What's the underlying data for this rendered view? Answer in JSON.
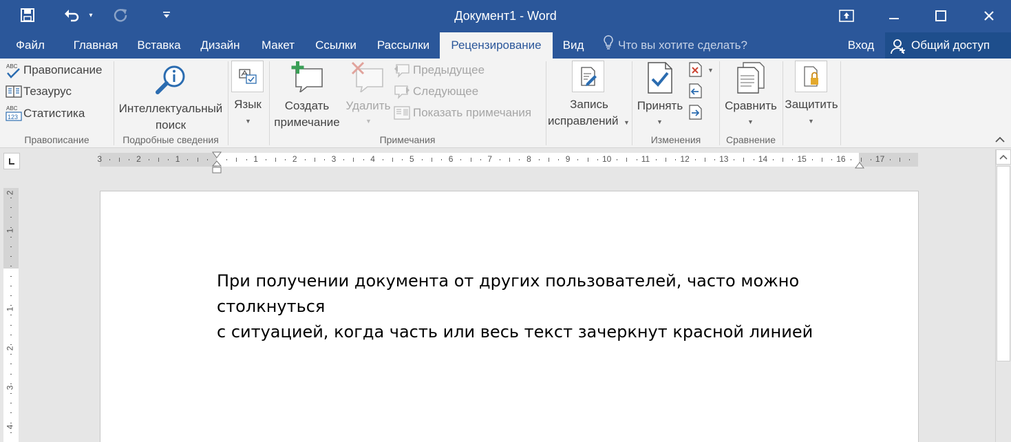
{
  "window": {
    "title": "Документ1 - Word"
  },
  "quick_access": {
    "save": "save-icon",
    "undo": "undo-icon",
    "redo": "redo-icon",
    "customize": "customize-icon"
  },
  "tabs": [
    "Файл",
    "Главная",
    "Вставка",
    "Дизайн",
    "Макет",
    "Ссылки",
    "Рассылки",
    "Рецензирование",
    "Вид"
  ],
  "active_tab": "Рецензирование",
  "tell_me": {
    "placeholder": "Что вы хотите сделать?"
  },
  "signin": "Вход",
  "share": "Общий доступ",
  "ribbon": {
    "proofing": {
      "spelling": "Правописание",
      "thesaurus": "Тезаурус",
      "wordcount": "Статистика",
      "abc": "ABC",
      "abc_small": "ABC",
      "num": "123",
      "group": "Правописание"
    },
    "insights": {
      "line1": "Интеллектуальный",
      "line2": "поиск",
      "group": "Подробные сведения"
    },
    "language": {
      "label": "Язык"
    },
    "comments": {
      "new1": "Создать",
      "new2": "примечание",
      "delete": "Удалить",
      "previous": "Предыдущее",
      "next": "Следующее",
      "show": "Показать примечания",
      "group": "Примечания"
    },
    "tracking": {
      "line1": "Запись",
      "line2": "исправлений"
    },
    "changes": {
      "accept": "Принять",
      "group": "Изменения"
    },
    "compare": {
      "label": "Сравнить",
      "group": "Сравнение"
    },
    "protect": {
      "label": "Защитить"
    }
  },
  "ruler": {
    "ticks": [
      "3",
      "2",
      "1",
      "1",
      "2",
      "3",
      "4",
      "5",
      "6",
      "7",
      "8",
      "9",
      "10",
      "11",
      "12",
      "13",
      "14",
      "15",
      "16",
      "17"
    ],
    "vticks": [
      "2",
      "1",
      "1",
      "2",
      "3",
      "4"
    ]
  },
  "document": {
    "line1": "При получении документа от других пользователей, часто можно столкнуться",
    "line2": "с ситуацией, когда часть или весь текст зачеркнут красной линией"
  },
  "colors": {
    "title_bar": "#2b579a",
    "ribbon": "#f3f3f3",
    "canvas": "#e6e6e6",
    "share": "#1e4e8c"
  }
}
